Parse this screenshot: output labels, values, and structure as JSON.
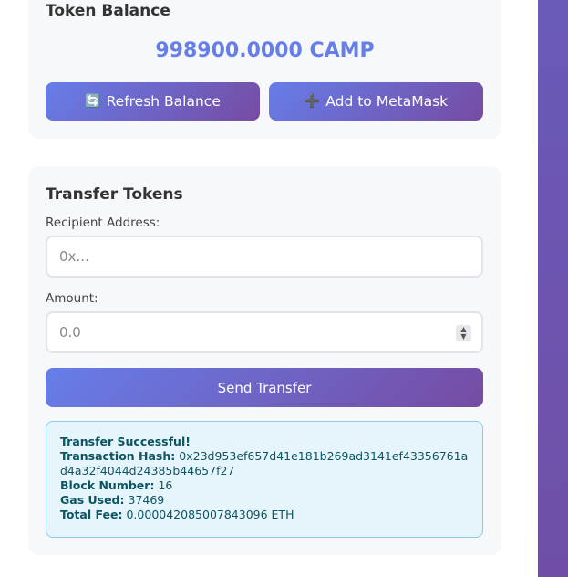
{
  "balance_card": {
    "title": "Token Balance",
    "balance": "998900.0000 CAMP",
    "refresh_icon": "🔄",
    "refresh_label": "Refresh Balance",
    "metamask_icon": "➕",
    "metamask_label": "Add to MetaMask"
  },
  "transfer_card": {
    "title": "Transfer Tokens",
    "recipient_label": "Recipient Address:",
    "recipient_placeholder": "0x...",
    "amount_label": "Amount:",
    "amount_placeholder": "0.0",
    "send_label": "Send Transfer"
  },
  "result": {
    "heading": "Transfer Successful!",
    "hash_label": "Transaction Hash:",
    "hash_value": "0x23d953ef657d41e181b269ad3141ef43356761ad4a32f4044d24385b44657f27",
    "block_label": "Block Number:",
    "block_value": "16",
    "gas_label": "Gas Used:",
    "gas_value": "37469",
    "fee_label": "Total Fee:",
    "fee_value": "0.000042085007843096 ETH"
  },
  "colors": {
    "accent": "#667eea",
    "gradient_end": "#764ba2",
    "success_bg": "#e6f4fb"
  }
}
